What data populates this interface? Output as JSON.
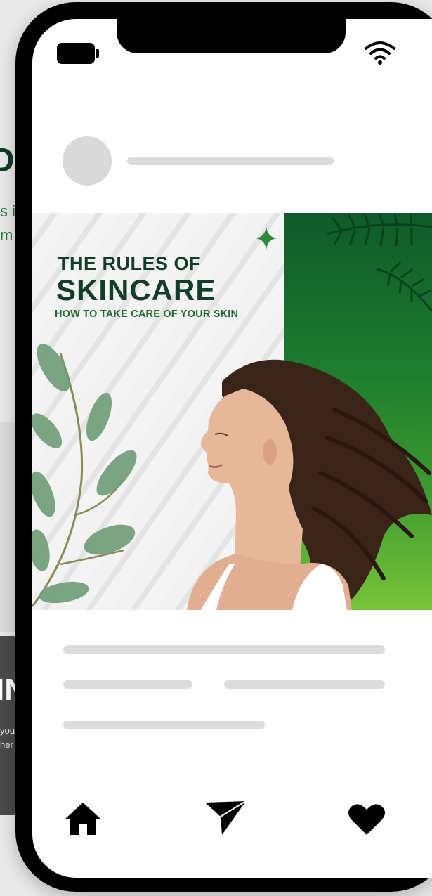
{
  "background": {
    "big_letter": "D",
    "line1": "s is",
    "line2": "m",
    "dark_letter": "IN",
    "dark_small1": "you",
    "dark_small2": "her"
  },
  "status_bar": {
    "battery_icon": "battery-icon",
    "wifi_icon": "wifi-icon"
  },
  "post": {
    "title_line1": "THE RULES OF",
    "title_line2": "SKINCARE",
    "subtitle": "HOW TO TAKE CARE OF YOUR SKIN",
    "accent_dark": "#123d26",
    "accent_green": "#1d6b30"
  },
  "bottom_nav": {
    "home_icon": "home-icon",
    "send_icon": "send-icon",
    "heart_icon": "heart-icon"
  }
}
